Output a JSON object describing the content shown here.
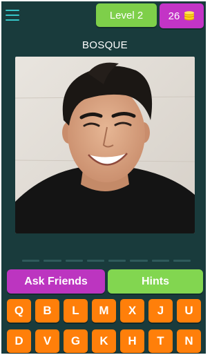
{
  "header": {
    "menu_icon": "hamburger-menu-icon",
    "level_label": "Level 2",
    "coins": "26",
    "coins_icon": "coins-stack-icon"
  },
  "puzzle": {
    "hint_word": "BOSQUE",
    "answer_slot_count": 8
  },
  "actions": {
    "ask_friends": "Ask Friends",
    "hints": "Hints"
  },
  "letters": [
    "Q",
    "B",
    "L",
    "M",
    "X",
    "J",
    "U",
    "D",
    "V",
    "G",
    "K",
    "H",
    "T",
    "N"
  ],
  "colors": {
    "background": "#193b3c",
    "accent_teal": "#36c6c9",
    "green": "#7ecf4a",
    "purple": "#c334c6",
    "orange_key": "#ff7f0a"
  }
}
